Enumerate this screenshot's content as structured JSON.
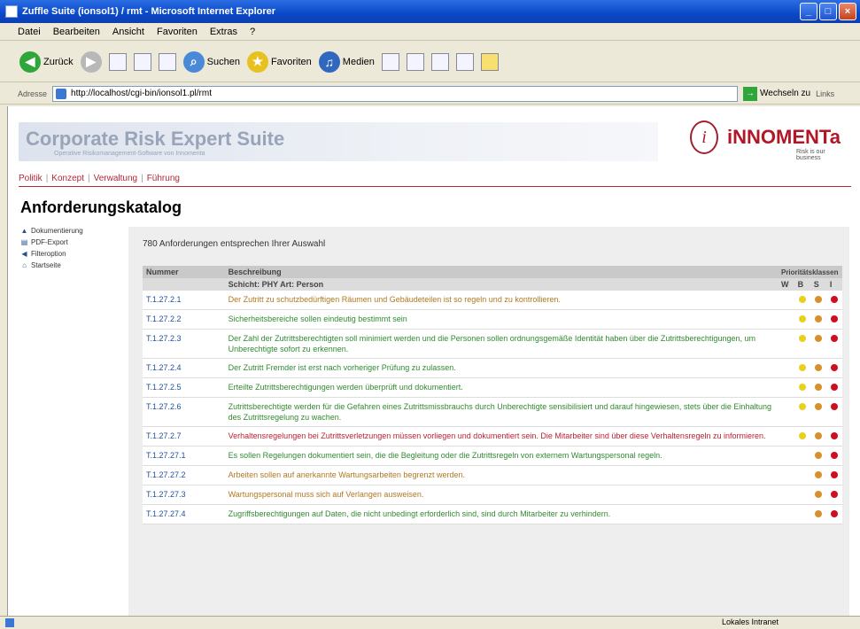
{
  "window": {
    "title": "Zuffle Suite (ionsol1) / rmt - Microsoft Internet Explorer"
  },
  "menu": [
    "Datei",
    "Bearbeiten",
    "Ansicht",
    "Favoriten",
    "Extras",
    "?"
  ],
  "toolbar": {
    "back": "Zurück",
    "search": "Suchen",
    "favorites": "Favoriten",
    "media": "Medien"
  },
  "address": {
    "label": "Adresse",
    "url": "http://localhost/cgi-bin/ionsol1.pl/rmt",
    "go": "Wechseln zu",
    "links": "Links"
  },
  "site": {
    "brand": "Corporate Risk Expert Suite",
    "brand_sub": "Operative Risikomanagement-Software von Innomenta",
    "logo_word": "iNNOMENTa",
    "logo_tag": "Risk is our business",
    "nav": [
      "Politik",
      "Konzept",
      "Verwaltung",
      "Führung"
    ]
  },
  "page_title": "Anforderungskatalog",
  "sidebar": [
    "Dokumentierung",
    "PDF-Export",
    "Filteroption",
    "Startseite"
  ],
  "panel": {
    "heading": "780  Anforderungen entsprechen Ihrer Auswahl",
    "col_nr": "Nummer",
    "col_desc": "Beschreibung",
    "col_prio": "Prioritätsklassen",
    "sub_desc": "Schicht: PHY     Art: Person",
    "sub_prio": [
      "W",
      "B",
      "S",
      "I"
    ]
  },
  "rows": [
    {
      "nr": "T.1.27.2.1",
      "text": "Der Zutritt zu schutzbedürftigen Räumen und Gebäudeteilen ist so regeln und zu kontrollieren.",
      "color": "#b07820",
      "dots": [
        "#e8d020",
        "#d89028",
        "#cc1020"
      ]
    },
    {
      "nr": "T.1.27.2.2",
      "text": "Sicherheitsbereiche sollen eindeutig bestimmt sein",
      "color": "#308a30",
      "dots": [
        "#e8d020",
        "#d89028",
        "#cc1020"
      ]
    },
    {
      "nr": "T.1.27.2.3",
      "text": "Der Zahl der Zutrittsberechtigten soll minimiert werden und die Personen sollen ordnungsgemäße Identität haben über die Zutrittsberechtigungen, um Unberechtigte sofort zu erkennen.",
      "color": "#308a30",
      "dots": [
        "#e8d020",
        "#d89028",
        "#cc1020"
      ]
    },
    {
      "nr": "T.1.27.2.4",
      "text": "Der Zutritt Fremder ist erst nach vorheriger Prüfung zu zulassen.",
      "color": "#308a30",
      "dots": [
        "#e8d020",
        "#d89028",
        "#cc1020"
      ]
    },
    {
      "nr": "T.1.27.2.5",
      "text": "Erteilte Zutrittsberechtigungen werden überprüft und dokumentiert.",
      "color": "#308a30",
      "dots": [
        "#e8d020",
        "#d89028",
        "#cc1020"
      ]
    },
    {
      "nr": "T.1.27.2.6",
      "text": "Zutrittsberechtigte werden für die Gefahren eines Zutrittsmissbrauchs durch Unberechtigte sensibilisiert und darauf hingewiesen, stets über die Einhaltung des Zutrittsregelung zu wachen.",
      "color": "#308a30",
      "dots": [
        "#e8d020",
        "#d89028",
        "#cc1020"
      ]
    },
    {
      "nr": "T.1.27.2.7",
      "text": "Verhaltensregelungen bei Zutrittsverletzungen müssen vorliegen und dokumentiert sein. Die Mitarbeiter sind über diese Verhaltensregeln zu informieren.",
      "color": "#c02030",
      "dots": [
        "#e8d020",
        "#d89028",
        "#cc1020"
      ]
    },
    {
      "nr": "T.1.27.27.1",
      "text": "Es sollen Regelungen dokumentiert sein, die die Begleitung oder die Zutrittsregeln von externem Wartungspersonal regeln.",
      "color": "#308a30",
      "dots": [
        "",
        "#d89028",
        "#cc1020"
      ]
    },
    {
      "nr": "T.1.27.27.2",
      "text": "Arbeiten sollen auf anerkannte Wartungsarbeiten begrenzt werden.",
      "color": "#b07820",
      "dots": [
        "",
        "#d89028",
        "#cc1020"
      ]
    },
    {
      "nr": "T.1.27.27.3",
      "text": "Wartungspersonal muss sich auf Verlangen ausweisen.",
      "color": "#b07820",
      "dots": [
        "",
        "#d89028",
        "#cc1020"
      ]
    },
    {
      "nr": "T.1.27.27.4",
      "text": "Zugriffsberechtigungen auf Daten, die nicht unbedingt erforderlich sind, sind durch Mitarbeiter zu verhindern.",
      "color": "#308a30",
      "dots": [
        "",
        "#d89028",
        "#cc1020"
      ]
    }
  ],
  "status": {
    "zone": "Lokales Intranet"
  }
}
